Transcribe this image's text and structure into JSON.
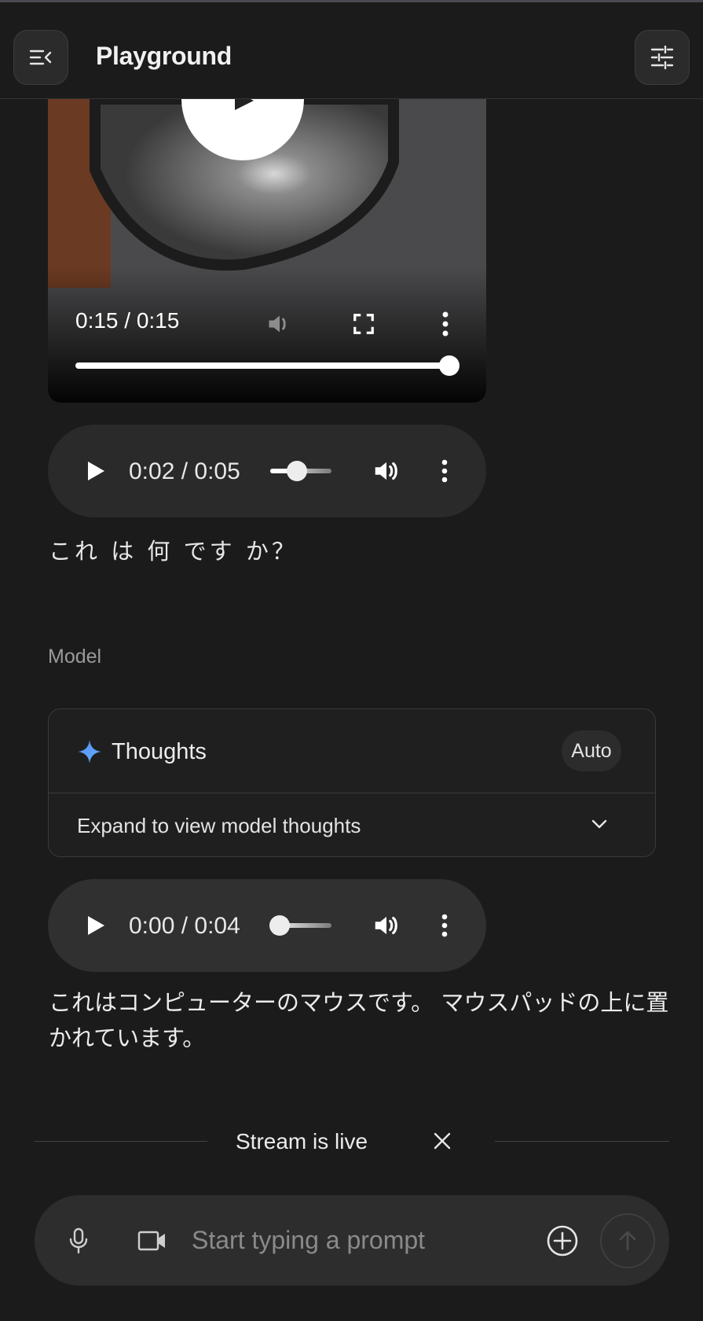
{
  "header": {
    "title": "Playground",
    "menu_icon": "menu-collapse-icon",
    "settings_icon": "tune-icon"
  },
  "video": {
    "time": "0:15 / 0:15",
    "progress": 1.0,
    "icons": [
      "play-icon",
      "volume-muted-icon",
      "fullscreen-icon",
      "more-vert-icon"
    ]
  },
  "user_turn": {
    "audio": {
      "time": "0:02 / 0:05",
      "progress": 0.4
    },
    "text": "これ は 何 です か？"
  },
  "model_turn": {
    "role_label": "Model",
    "thoughts": {
      "title": "Thoughts",
      "badge": "Auto",
      "expand_label": "Expand to view model thoughts"
    },
    "audio": {
      "time": "0:00 / 0:04",
      "progress": 0.0
    },
    "text": "これはコンピューターのマウスです。 マウスパッドの上に置かれています。"
  },
  "stream": {
    "status": "Stream is live"
  },
  "prompt": {
    "placeholder": "Start typing a prompt"
  },
  "colors": {
    "background": "#1b1b1b",
    "accent_sparkle": "#4f8df9"
  }
}
